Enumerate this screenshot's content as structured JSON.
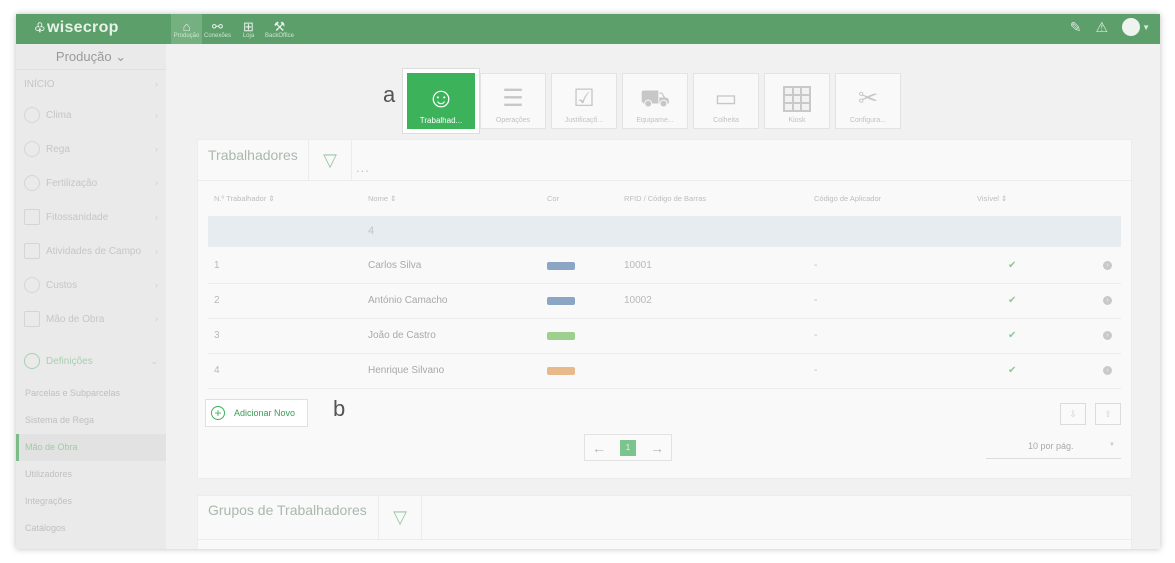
{
  "app": {
    "logo": "wisecrop"
  },
  "topnav": [
    {
      "label": "Produção",
      "icon": "plant-icon"
    },
    {
      "label": "Conexões",
      "icon": "network-icon"
    },
    {
      "label": "Loja",
      "icon": "store-icon"
    },
    {
      "label": "BackOffice",
      "icon": "factory-icon"
    }
  ],
  "sidebar": {
    "section": "Produção",
    "items": [
      {
        "label": "INÍCIO"
      },
      {
        "label": "Clima"
      },
      {
        "label": "Rega"
      },
      {
        "label": "Fertilização"
      },
      {
        "label": "Fitossanidade"
      },
      {
        "label": "Atividades de Campo"
      },
      {
        "label": "Custos"
      },
      {
        "label": "Mão de Obra"
      },
      {
        "label": "Definições"
      }
    ],
    "subitems": [
      {
        "label": "Parcelas e Subparcelas"
      },
      {
        "label": "Sistema de Rega"
      },
      {
        "label": "Mão de Obra"
      },
      {
        "label": "Utilizadores"
      },
      {
        "label": "Integrações"
      },
      {
        "label": "Catálogos"
      }
    ]
  },
  "modules": [
    {
      "label": "Trabalhad...",
      "icon": "worker-icon"
    },
    {
      "label": "Operações",
      "icon": "list-icon"
    },
    {
      "label": "Justificaçõ...",
      "icon": "justification-icon"
    },
    {
      "label": "Equipame...",
      "icon": "tractor-icon"
    },
    {
      "label": "Colheita",
      "icon": "harvest-icon"
    },
    {
      "label": "Kiosk",
      "icon": "kiosk-icon"
    },
    {
      "label": "Configura...",
      "icon": "tools-icon"
    }
  ],
  "markers": {
    "a": "a",
    "b": "b"
  },
  "workers": {
    "title": "Trabalhadores",
    "more": "...",
    "columns": [
      "N.º Trabalhador ⇕",
      "Nome ⇕",
      "Cor",
      "RFID / Código de Barras",
      "Código de Aplicador",
      "Visível ⇕"
    ],
    "filter_value": "4",
    "rows": [
      {
        "num": "1",
        "name": "Carlos Silva",
        "color": "#8aa6c4",
        "rfid": "10001",
        "applicator": "-",
        "visible": "✔"
      },
      {
        "num": "2",
        "name": "António Camacho",
        "color": "#8aa6c4",
        "rfid": "10002",
        "applicator": "-",
        "visible": "✔"
      },
      {
        "num": "3",
        "name": "João de Castro",
        "color": "#9dcf8e",
        "rfid": "",
        "applicator": "-",
        "visible": "✔"
      },
      {
        "num": "4",
        "name": "Henrique Silvano",
        "color": "#e7b98b",
        "rfid": "",
        "applicator": "-",
        "visible": "✔"
      }
    ],
    "add_new": "Adicionar Novo",
    "page": "1",
    "per_page": "10 por pág."
  },
  "groups": {
    "title": "Grupos de Trabalhadores"
  }
}
